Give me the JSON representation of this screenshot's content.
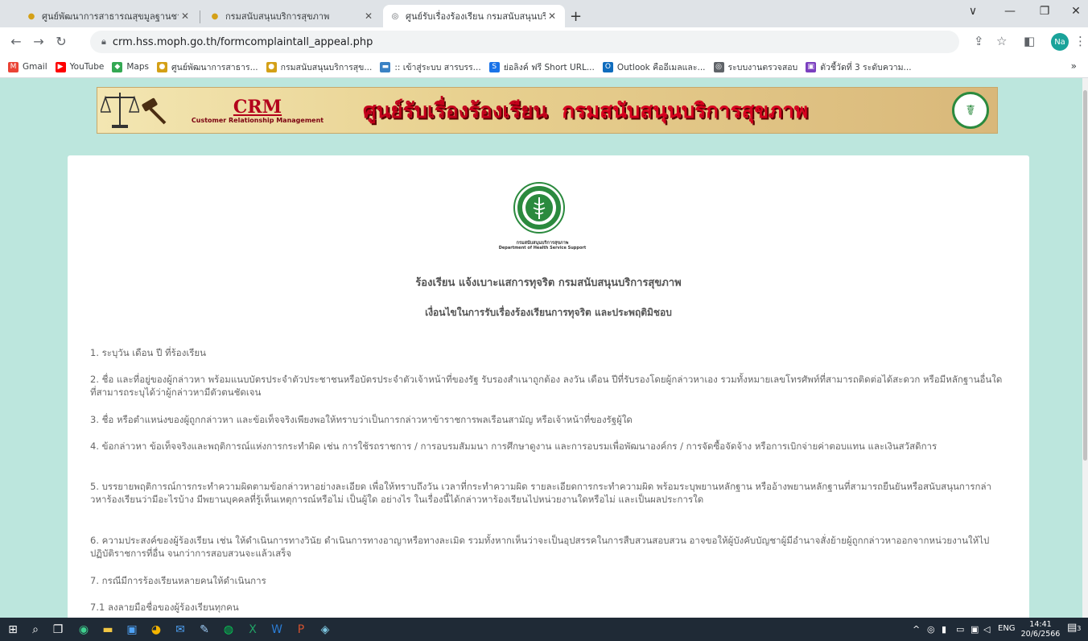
{
  "browser": {
    "tabs": [
      {
        "title": "ศูนย์พัฒนาการสาธารณสุขมูลฐานชายแ",
        "close": "✕"
      },
      {
        "title": "กรมสนับสนุนบริการสุขภาพ",
        "close": "✕"
      },
      {
        "title": "ศูนย์รับเรื่องร้องเรียน กรมสนับสนุนบริก",
        "close": "✕"
      }
    ],
    "new_tab": "+",
    "window_controls": {
      "dropdown": "∨",
      "minimize": "—",
      "restore": "❐",
      "close": "✕"
    },
    "url": "crm.hss.moph.go.th/formcomplaintall_appeal.php",
    "profile_initials": "Na",
    "bookmarks": [
      {
        "label": "Gmail",
        "color": "#ea4335",
        "glyph": "M"
      },
      {
        "label": "YouTube",
        "color": "#ff0000",
        "glyph": "▶"
      },
      {
        "label": "Maps",
        "color": "#34a853",
        "glyph": "◆"
      },
      {
        "label": "ศูนย์พัฒนาการสาธาร...",
        "color": "#d4a017",
        "glyph": "●"
      },
      {
        "label": "กรมสนับสนุนบริการสุข...",
        "color": "#d4a017",
        "glyph": "●"
      },
      {
        "label": ":: เข้าสู่ระบบ สารบรร...",
        "color": "#3b82c4",
        "glyph": "▬"
      },
      {
        "label": "ย่อลิงค์ ฟรี Short URL...",
        "color": "#1a73e8",
        "glyph": "S"
      },
      {
        "label": "Outlook คืออีเมลและ...",
        "color": "#0f6cbd",
        "glyph": "O"
      },
      {
        "label": "ระบบงานตรวจสอบ",
        "color": "#5f6368",
        "glyph": "◎"
      },
      {
        "label": "ตัวชี้วัดที่ 3 ระดับความ...",
        "color": "#7b3fbf",
        "glyph": "▣"
      }
    ],
    "bookmarks_more": "»"
  },
  "banner": {
    "crm": "CRM",
    "crm_sub": "Customer Relationship Management",
    "title_part1": "ศูนย์รับเรื่องร้องเรียน",
    "title_part2": "กรมสนับสนุนบริการสุขภาพ"
  },
  "logo": {
    "caption_th": "กรมสนับสนุนบริการสุขภาพ",
    "caption_en": "Department of Health Service Support"
  },
  "page": {
    "heading": "ร้องเรียน แจ้งเบาะแสการทุจริต กรมสนับสนุนบริการสุขภาพ",
    "subheading": "เงื่อนไขในการรับเรื่องร้องเรียนการทุจริต และประพฤติมิชอบ",
    "items": [
      "1. ระบุวัน เดือน ปี ที่ร้องเรียน",
      "2. ชื่อ และที่อยู่ของผู้กล่าวหา พร้อมแนบบัตรประจำตัวประชาชนหรือบัตรประจำตัวเจ้าหน้าที่ของรัฐ รับรองสำเนาถูกต้อง ลงวัน เดือน ปีที่รับรองโดยผู้กล่าวหาเอง รวมทั้งหมายเลขโทรศัพท์ที่สามารถติดต่อได้สะดวก หรือมีหลักฐานอื่นใดที่สามารถระบุได้ว่าผู้กล่าวหามีตัวตนชัดเจน",
      "3. ชื่อ หรือตำแหน่งของผู้ถูกกล่าวหา และข้อเท็จจริงเพียงพอให้ทราบว่าเป็นการกล่าวหาข้าราชการพลเรือนสามัญ หรือเจ้าหน้าที่ของรัฐผู้ใด",
      "4. ข้อกล่าวหา ข้อเท็จจริงและพฤติการณ์แห่งการกระทำผิด เช่น การใช้รถราชการ / การอบรมสัมมนา การศึกษาดูงาน และการอบรมเพื่อพัฒนาองค์กร / การจัดซื้อจัดจ้าง หรือการเบิกจ่ายค่าตอบแทน และเงินสวัสดิการ",
      "5. บรรยายพฤติการณ์การกระทำความผิดตามข้อกล่าวหาอย่างละเอียด เพื่อให้ทราบถึงวัน เวลาที่กระทำความผิด รายละเอียดการกระทำความผิด พร้อมระบุพยานหลักฐาน หรืออ้างพยานหลักฐานที่สามารถยืนยันหรือสนับสนุนการกล่าวหาร้องเรียนว่ามีอะไรบ้าง มีพยานบุคคลที่รู้เห็นเหตุการณ์หรือไม่ เป็นผู้ใด อย่างไร ในเรื่องนี้ได้กล่าวหาร้องเรียนไปหน่วยงานใดหรือไม่ และเป็นผลประการใด",
      "6. ความประสงค์ของผู้ร้องเรียน เช่น ให้ดำเนินการทางวินัย ดำเนินการทางอาญาหรือทางละเมิด รวมทั้งหากเห็นว่าจะเป็นอุปสรรคในการสืบสวนสอบสวน อาจขอให้ผู้บังคับบัญชาผู้มีอำนาจสั่งย้ายผู้ถูกกล่าวหาออกจากหน่วยงานให้ไปปฏิบัติราชการที่อื่น จนกว่าการสอบสวนจะแล้วเสร็จ",
      "7. กรณีมีการร้องเรียนหลายคนให้ดำเนินการ",
      "7.1 ลงลายมือชื่อของผู้ร้องเรียนทุกคน"
    ]
  },
  "taskbar": {
    "lang": "ENG",
    "time": "14:41",
    "date": "20/6/2566",
    "notif_count": "3"
  },
  "colors": {
    "page_bg": "#bce6dd",
    "taskbar": "#1f2a36",
    "banner_red": "#c4001c"
  }
}
